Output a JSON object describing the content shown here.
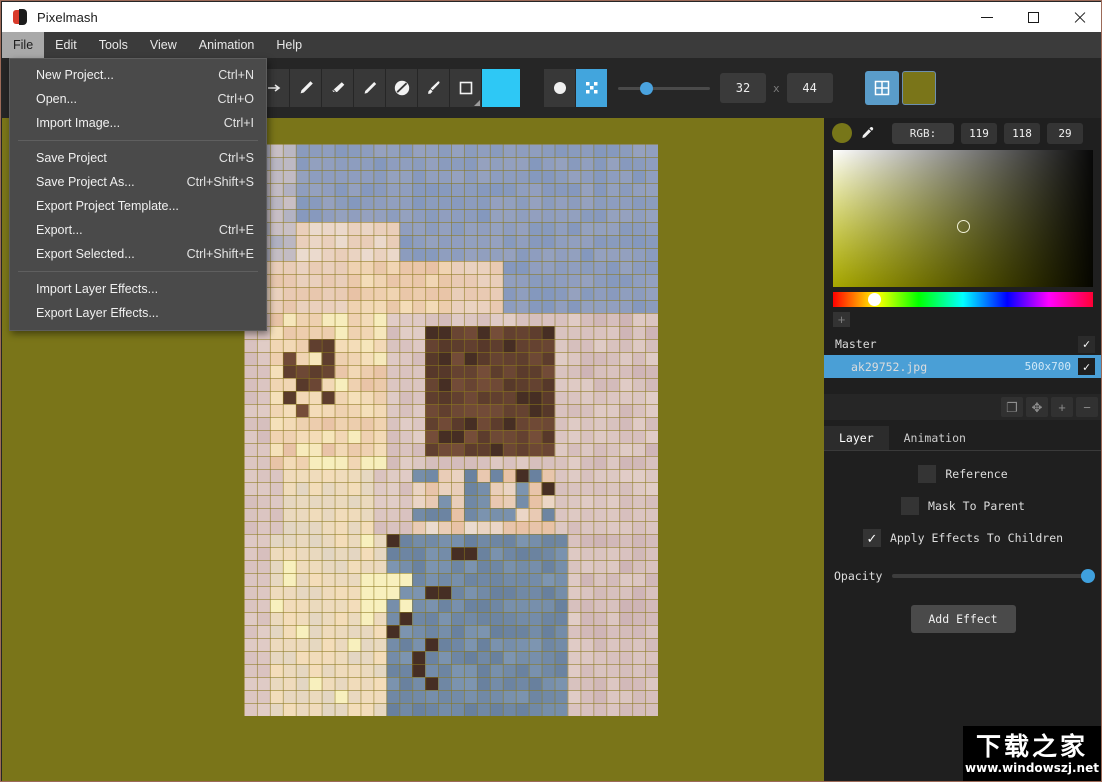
{
  "window": {
    "title": "Pixelmash",
    "logo_icon": "pixelmash-logo-icon",
    "minimize_label": "—",
    "maximize_label": "□",
    "close_label": "×"
  },
  "menubar": {
    "items": [
      {
        "label": "File",
        "open": true
      },
      {
        "label": "Edit",
        "open": false
      },
      {
        "label": "Tools",
        "open": false
      },
      {
        "label": "View",
        "open": false
      },
      {
        "label": "Animation",
        "open": false
      },
      {
        "label": "Help",
        "open": false
      }
    ]
  },
  "file_menu": {
    "groups": [
      [
        {
          "label": "New Project...",
          "shortcut": "Ctrl+N"
        },
        {
          "label": "Open...",
          "shortcut": "Ctrl+O"
        },
        {
          "label": "Import Image...",
          "shortcut": "Ctrl+I"
        }
      ],
      [
        {
          "label": "Save Project",
          "shortcut": "Ctrl+S"
        },
        {
          "label": "Save Project As...",
          "shortcut": "Ctrl+Shift+S"
        },
        {
          "label": "Export Project Template...",
          "shortcut": ""
        },
        {
          "label": "Export...",
          "shortcut": "Ctrl+E"
        },
        {
          "label": "Export Selected...",
          "shortcut": "Ctrl+Shift+E"
        }
      ],
      [
        {
          "label": "Import Layer Effects...",
          "shortcut": ""
        },
        {
          "label": "Export Layer Effects...",
          "shortcut": ""
        }
      ]
    ]
  },
  "toolbar": {
    "tools": [
      {
        "name": "arrow-move-icon",
        "active": false
      },
      {
        "name": "pencil-icon",
        "active": false
      },
      {
        "name": "eraser-icon",
        "active": false
      },
      {
        "name": "line-icon",
        "active": false
      },
      {
        "name": "paint-bucket-icon",
        "active": false
      },
      {
        "name": "brush-icon",
        "active": false
      },
      {
        "name": "rectangle-icon",
        "active": false
      }
    ],
    "foreground_color": "#2ec8f5",
    "shape_tools": [
      {
        "name": "circle-filled-icon",
        "active": false
      },
      {
        "name": "dither-pattern-icon",
        "active": true
      }
    ],
    "size_slider_value": 22,
    "width_value": "32",
    "height_value": "44",
    "dimension_separator": "x",
    "grid_toggle_icon": "grid-icon",
    "grid_toggle_active": true,
    "background_swatch_color": "#7a7519"
  },
  "canvas": {
    "background_color": "#7a7519",
    "grid_visible": true,
    "image_alt": "pixelated-portrait"
  },
  "color_picker": {
    "current_swatch": "#777619",
    "pipette_icon": "eyedropper-icon",
    "mode_label": "RGB:",
    "values": [
      "119",
      "118",
      "29"
    ],
    "add_swatch_label": "+"
  },
  "layers": {
    "rows": [
      {
        "name": "Master",
        "size": "",
        "visible": true,
        "selected": false,
        "child": false
      },
      {
        "name": "ak29752.jpg",
        "size": "500x700",
        "visible": true,
        "selected": true,
        "child": true
      }
    ],
    "visible_check": "✓",
    "tools": [
      {
        "name": "duplicate-layer-button",
        "glyph": "❐"
      },
      {
        "name": "move-layer-button",
        "glyph": "✥"
      },
      {
        "name": "add-layer-button",
        "glyph": "+"
      },
      {
        "name": "remove-layer-button",
        "glyph": "−"
      }
    ]
  },
  "properties": {
    "tabs": [
      {
        "label": "Layer",
        "active": true
      },
      {
        "label": "Animation",
        "active": false
      }
    ],
    "checkboxes": [
      {
        "label": "Reference",
        "checked": false
      },
      {
        "label": "Mask To Parent",
        "checked": false
      },
      {
        "label": "Apply Effects To Children",
        "checked": true
      }
    ],
    "check_glyph": "✓",
    "opacity_label": "Opacity",
    "opacity_value": 100,
    "add_effect_label": "Add Effect"
  },
  "watermark": {
    "text_cn": "下载之家",
    "url": "www.windowszj.net"
  }
}
